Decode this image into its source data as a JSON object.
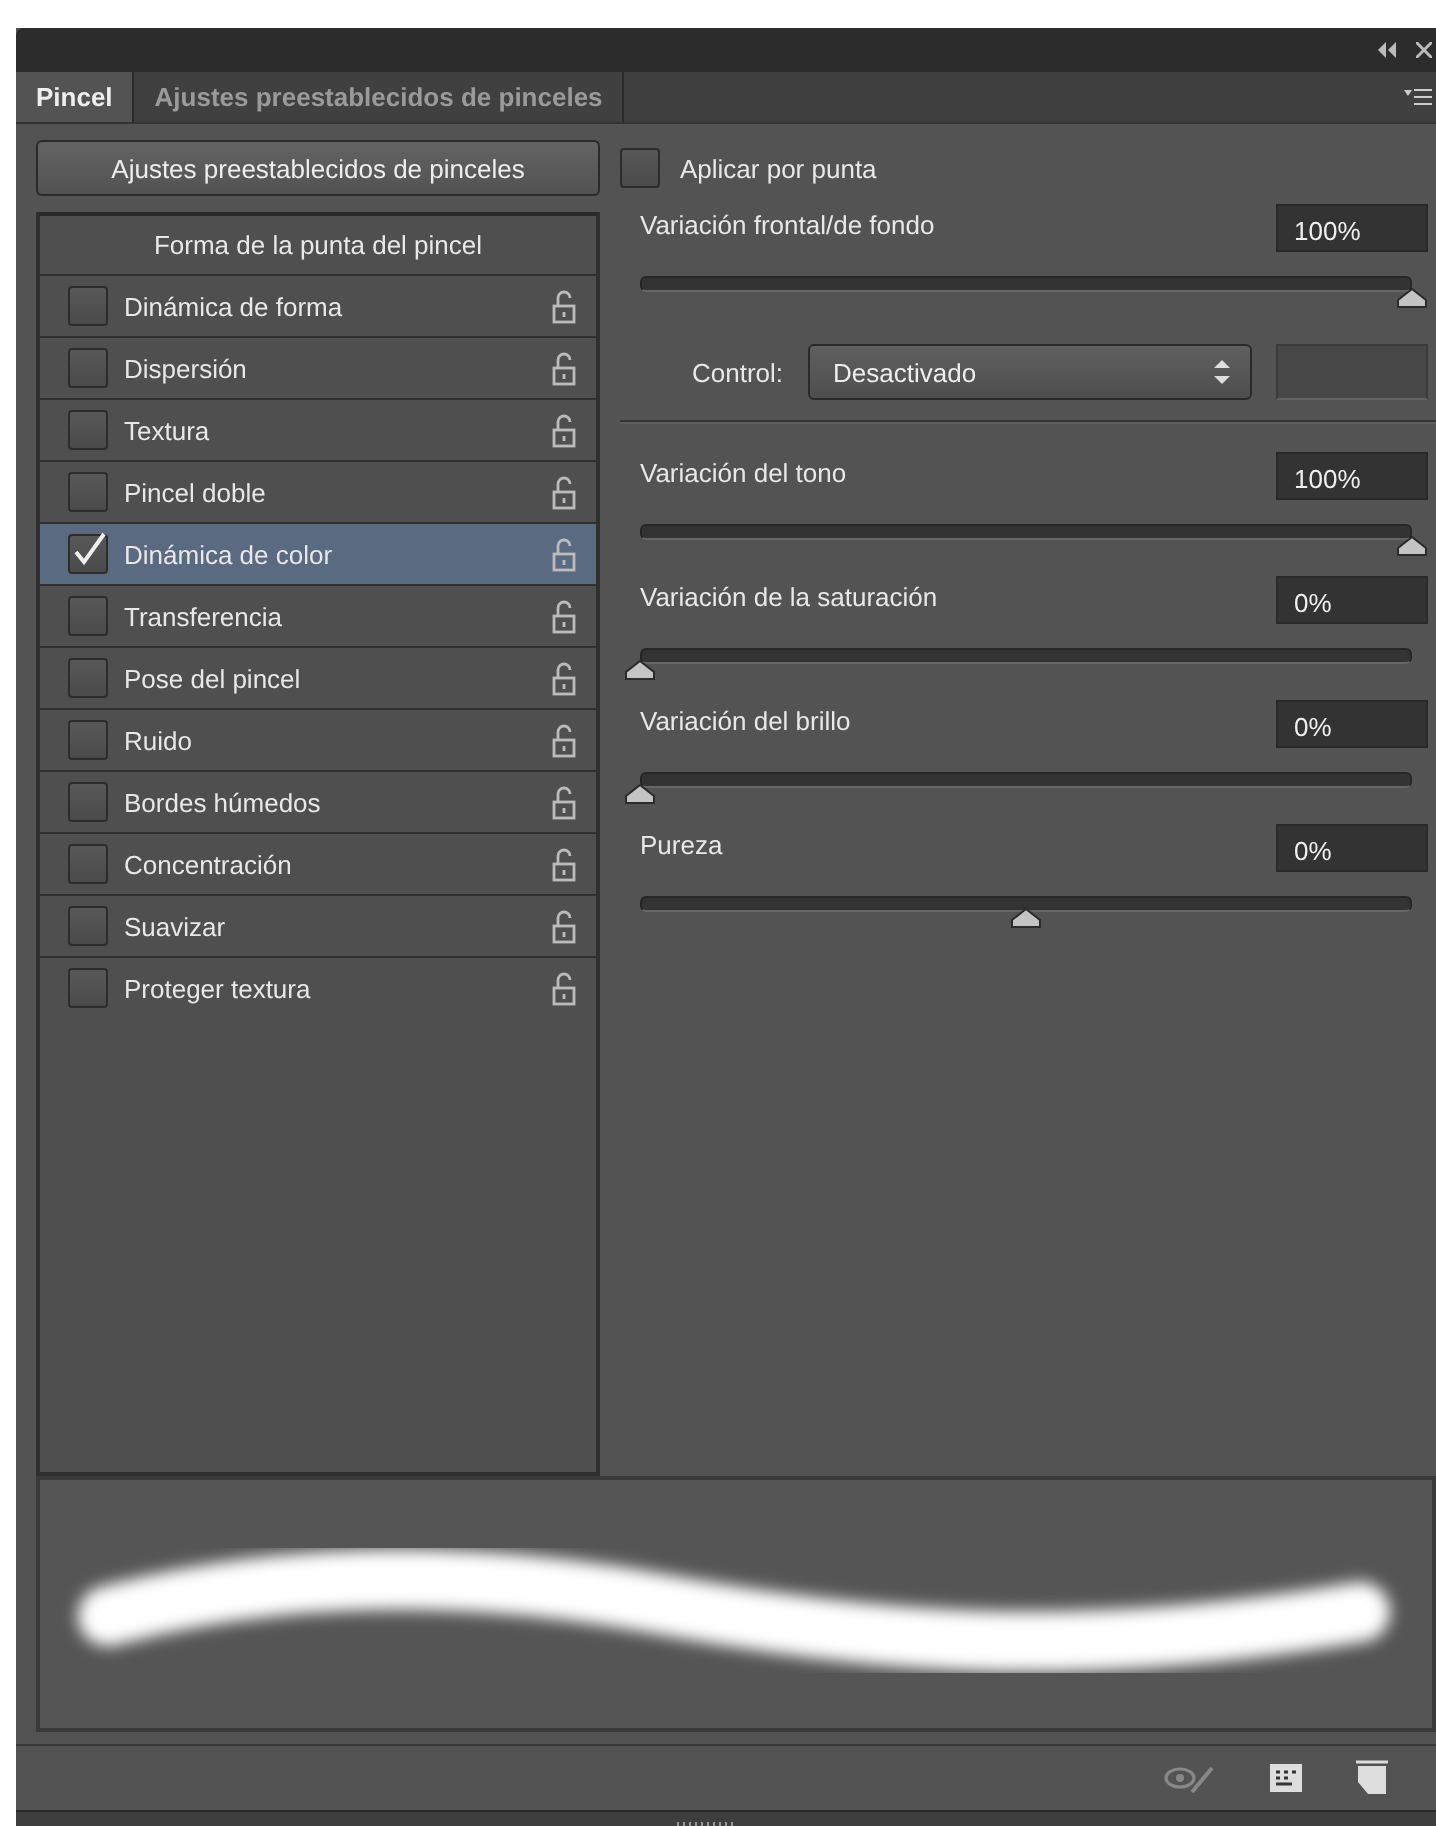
{
  "tabs": [
    {
      "label": "Pincel",
      "selected": true
    },
    {
      "label": "Ajustes preestablecidos de pinceles",
      "selected": false
    }
  ],
  "presets_button": "Ajustes preestablecidos de pinceles",
  "apply_per_tip": {
    "label": "Aplicar por punta",
    "checked": false
  },
  "options_header": "Forma de la punta del pincel",
  "options": [
    {
      "label": "Dinámica de forma",
      "checked": false,
      "selected": false
    },
    {
      "label": "Dispersión",
      "checked": false,
      "selected": false
    },
    {
      "label": "Textura",
      "checked": false,
      "selected": false
    },
    {
      "label": "Pincel doble",
      "checked": false,
      "selected": false
    },
    {
      "label": "Dinámica de color",
      "checked": true,
      "selected": true
    },
    {
      "label": "Transferencia",
      "checked": false,
      "selected": false
    },
    {
      "label": "Pose del pincel",
      "checked": false,
      "selected": false
    },
    {
      "label": "Ruido",
      "checked": false,
      "selected": false
    },
    {
      "label": "Bordes húmedos",
      "checked": false,
      "selected": false
    },
    {
      "label": "Concentración",
      "checked": false,
      "selected": false
    },
    {
      "label": "Suavizar",
      "checked": false,
      "selected": false
    },
    {
      "label": "Proteger textura",
      "checked": false,
      "selected": false
    }
  ],
  "settings": [
    {
      "kind": "slider",
      "label": "Variación frontal/de fondo",
      "value": "100%",
      "level": 1
    },
    {
      "kind": "control",
      "label": "Control:",
      "value": "Desactivado"
    },
    {
      "kind": "divider"
    },
    {
      "kind": "slider",
      "label": "Variación del tono",
      "value": "100%",
      "level": 1
    },
    {
      "kind": "slider",
      "label": "Variación de la saturación",
      "value": "0%",
      "level": 0
    },
    {
      "kind": "slider",
      "label": "Variación del brillo",
      "value": "0%",
      "level": 0
    },
    {
      "kind": "slider",
      "label": "Pureza",
      "value": "0%",
      "level": 0.5
    }
  ]
}
